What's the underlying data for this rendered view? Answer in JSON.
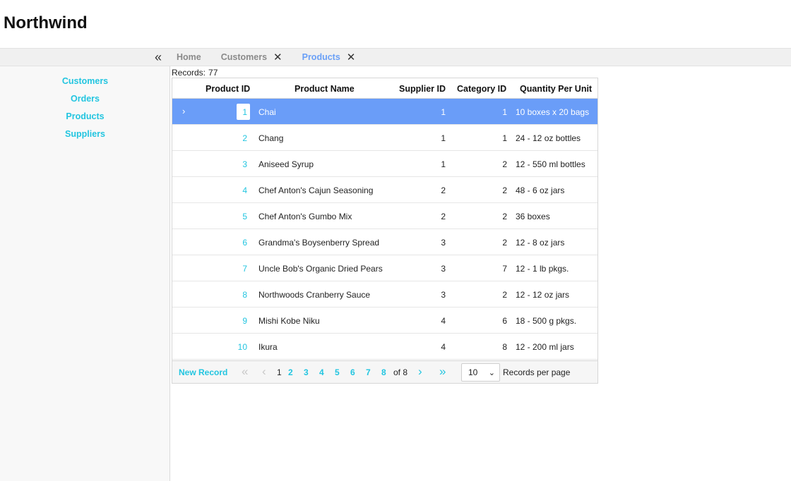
{
  "app": {
    "title": "Northwind"
  },
  "topbar": {
    "collapse_icon": "«",
    "tabs": [
      {
        "label": "Home",
        "closable": false,
        "active": false
      },
      {
        "label": "Customers",
        "closable": true,
        "active": false
      },
      {
        "label": "Products",
        "closable": true,
        "active": true
      }
    ],
    "close_glyph": "✕"
  },
  "sidebar": {
    "items": [
      {
        "label": "Customers"
      },
      {
        "label": "Orders"
      },
      {
        "label": "Products"
      },
      {
        "label": "Suppliers"
      }
    ]
  },
  "records": {
    "label": "Records:",
    "count": "77"
  },
  "grid": {
    "columns": [
      "Product ID",
      "Product Name",
      "Supplier ID",
      "Category ID",
      "Quantity Per Unit"
    ],
    "rows": [
      {
        "id": "1",
        "name": "Chai",
        "supplier": "1",
        "category": "1",
        "qty": "10 boxes x 20 bags"
      },
      {
        "id": "2",
        "name": "Chang",
        "supplier": "1",
        "category": "1",
        "qty": "24 - 12 oz bottles"
      },
      {
        "id": "3",
        "name": "Aniseed Syrup",
        "supplier": "1",
        "category": "2",
        "qty": "12 - 550 ml bottles"
      },
      {
        "id": "4",
        "name": "Chef Anton's Cajun Seasoning",
        "supplier": "2",
        "category": "2",
        "qty": "48 - 6 oz jars"
      },
      {
        "id": "5",
        "name": "Chef Anton's Gumbo Mix",
        "supplier": "2",
        "category": "2",
        "qty": "36 boxes"
      },
      {
        "id": "6",
        "name": "Grandma's Boysenberry Spread",
        "supplier": "3",
        "category": "2",
        "qty": "12 - 8 oz jars"
      },
      {
        "id": "7",
        "name": "Uncle Bob's Organic Dried Pears",
        "supplier": "3",
        "category": "7",
        "qty": "12 - 1 lb pkgs."
      },
      {
        "id": "8",
        "name": "Northwoods Cranberry Sauce",
        "supplier": "3",
        "category": "2",
        "qty": "12 - 12 oz jars"
      },
      {
        "id": "9",
        "name": "Mishi Kobe Niku",
        "supplier": "4",
        "category": "6",
        "qty": "18 - 500 g pkgs."
      },
      {
        "id": "10",
        "name": "Ikura",
        "supplier": "4",
        "category": "8",
        "qty": "12 - 200 ml jars"
      }
    ],
    "expander_icon": "›"
  },
  "pager": {
    "new_record": "New Record",
    "first_icon": "«",
    "prev_icon": "‹",
    "next_icon": "›",
    "last_icon": "»",
    "pages": [
      "1",
      "2",
      "3",
      "4",
      "5",
      "6",
      "7",
      "8"
    ],
    "current_page": "1",
    "of_total": "of 8",
    "page_size": "10",
    "page_size_chevron": "⌄",
    "records_per_page": "Records per page"
  },
  "colors": {
    "accent": "#22c5e0",
    "selected_row": "#6a9df8",
    "active_tab": "#6aa0f7"
  }
}
